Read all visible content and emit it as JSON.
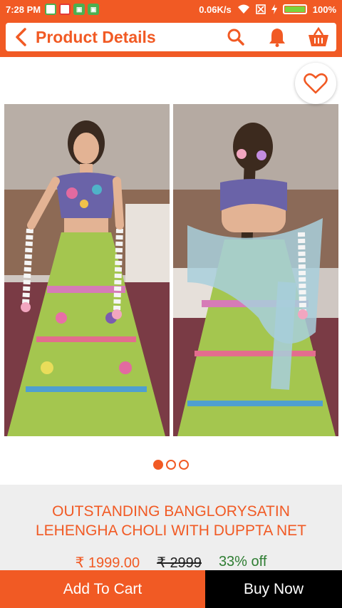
{
  "status_bar": {
    "time": "7:28 PM",
    "network_speed": "0.06K/s",
    "battery_percent": "100%"
  },
  "header": {
    "title": "Product Details",
    "icons": [
      "back-icon",
      "search-icon",
      "bell-icon",
      "basket-icon"
    ]
  },
  "gallery": {
    "wishlist_icon": "heart-icon",
    "page_count": 3,
    "active_index": 0
  },
  "product": {
    "name_line1": "OUTSTANDING BANGLORYSATIN",
    "name_line2": "LEHENGHA CHOLI WITH DUPPTA NET",
    "price": "₹ 1999.00",
    "mrp": "₹ 2999",
    "discount": "33% off"
  },
  "actions": {
    "add_to_cart": "Add To Cart",
    "buy_now": "Buy Now"
  },
  "colors": {
    "accent": "#f15a24",
    "buy_bg": "#000000",
    "discount": "#2e7d32"
  }
}
